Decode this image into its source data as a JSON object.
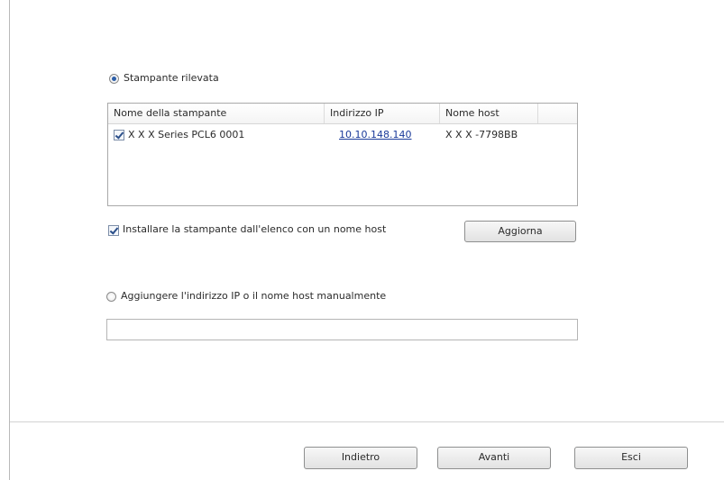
{
  "detected": {
    "radio_label": "Stampante rilevata",
    "selected": true
  },
  "printer_list": {
    "columns": [
      "Nome della stampante",
      "Indirizzo IP",
      "Nome host"
    ],
    "rows": [
      {
        "checked": true,
        "name": "X X X  Series PCL6 0001",
        "ip": "10.10.148.140",
        "host": "X X X -7798BB"
      }
    ]
  },
  "install_hostname": {
    "checked": true,
    "label": "Installare la stampante dall'elenco con un nome host"
  },
  "refresh_button": "Aggiorna",
  "manual": {
    "radio_label": "Aggiungere l'indirizzo IP o il nome host manualmente",
    "selected": false,
    "input_value": ""
  },
  "footer": {
    "back_label": "Indietro",
    "next_label": "Avanti",
    "exit_label": "Esci"
  }
}
